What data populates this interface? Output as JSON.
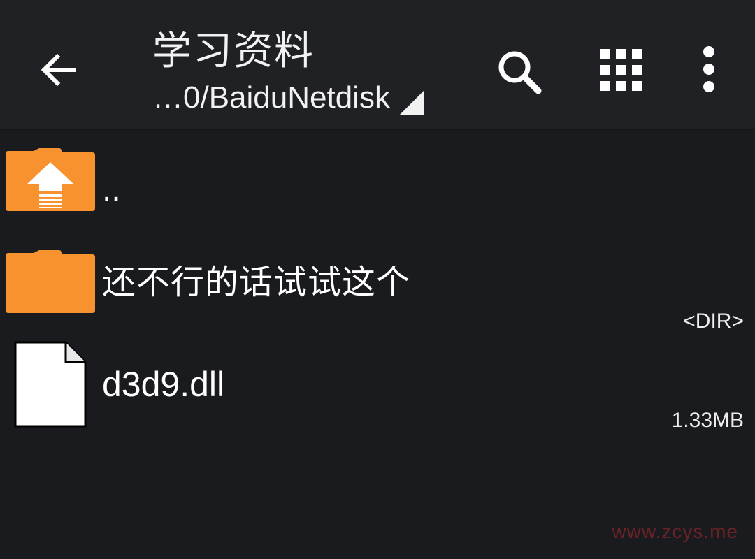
{
  "toolbar": {
    "title": "学习资料",
    "path": "…0/BaiduNetdisk",
    "back_icon": "arrow-left-icon",
    "search_icon": "search-icon",
    "view_icon": "grid-view-icon",
    "more_icon": "more-vert-icon"
  },
  "files": [
    {
      "name": "..",
      "icon": "folder-up-icon",
      "meta": ""
    },
    {
      "name": "还不行的话试试这个",
      "icon": "folder-icon",
      "meta": "<DIR>"
    },
    {
      "name": "d3d9.dll",
      "icon": "file-icon",
      "meta": "1.33MB"
    }
  ],
  "watermark": "www.zcys.me",
  "colors": {
    "toolbar_bg": "#202124",
    "list_bg": "#1a1b1e",
    "folder_orange": "#f7922e",
    "text": "#ffffff",
    "watermark": "#6b2226"
  }
}
